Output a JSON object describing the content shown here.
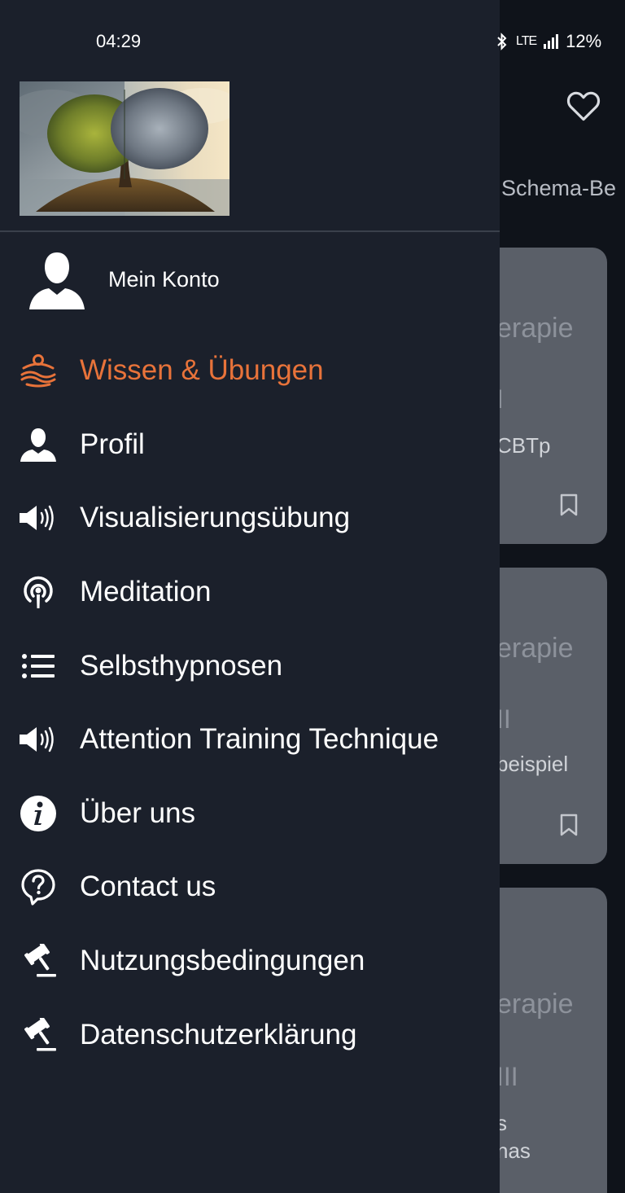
{
  "status_bar": {
    "time": "04:29",
    "network": "LTE",
    "battery": "12%"
  },
  "background": {
    "tab_label": "Schema-Be",
    "cards": [
      {
        "title": "erapie",
        "roman": "I",
        "subtitle": "CBTp"
      },
      {
        "title": "erapie",
        "roman": "II",
        "subtitle": "beispiel"
      },
      {
        "title": "erapie",
        "roman": "III",
        "subtitle": "s\nnas"
      }
    ]
  },
  "drawer": {
    "account_label": "Mein Konto",
    "items": [
      {
        "label": "Wissen & Übungen",
        "icon": "lotus-icon",
        "active": true
      },
      {
        "label": "Profil",
        "icon": "person-icon"
      },
      {
        "label": "Visualisierungsübung",
        "icon": "speaker-icon"
      },
      {
        "label": "Meditation",
        "icon": "podcast-icon"
      },
      {
        "label": "Selbsthypnosen",
        "icon": "list-icon"
      },
      {
        "label": "Attention Training Technique",
        "icon": "speaker-icon"
      },
      {
        "label": "Über uns",
        "icon": "info-icon"
      },
      {
        "label": "Contact us",
        "icon": "help-bubble-icon"
      },
      {
        "label": "Nutzungsbedingungen",
        "icon": "gavel-icon"
      },
      {
        "label": "Datenschutzerklärung",
        "icon": "gavel-icon"
      }
    ]
  },
  "colors": {
    "drawer_bg": "#1b202b",
    "accent": "#e8733a",
    "text": "#ffffff",
    "card_bg": "#5a5f68"
  }
}
